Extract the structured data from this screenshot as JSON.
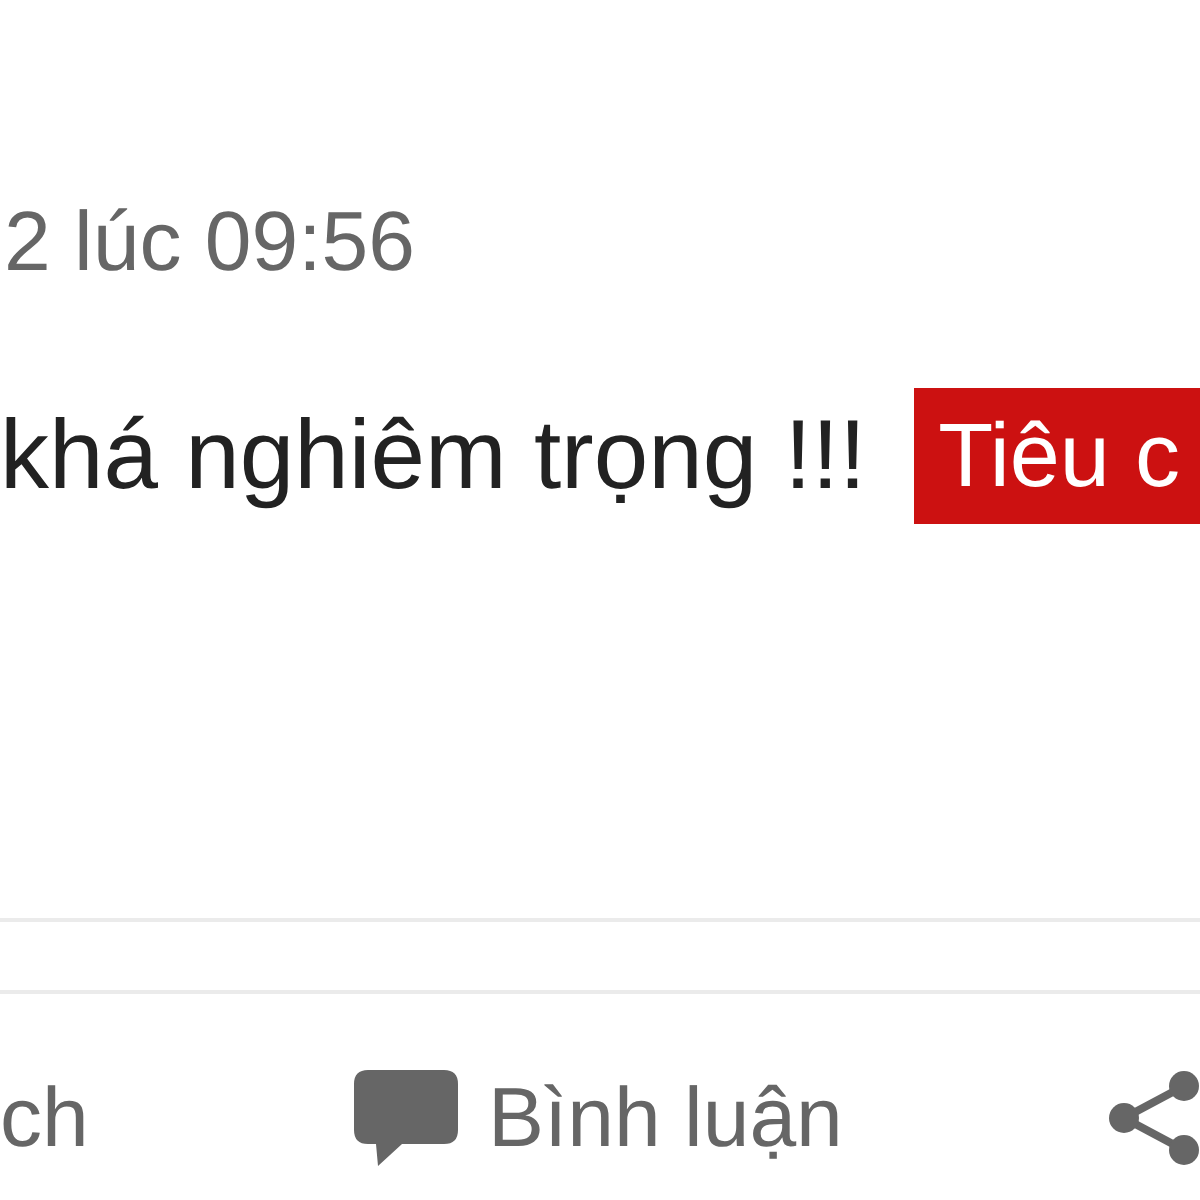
{
  "post": {
    "timestamp": "2 lúc 09:56",
    "text": "khá nghiêm trọng !!!",
    "tag": {
      "label": "Tiêu c"
    }
  },
  "actions": [
    {
      "kind": "text",
      "label": "ch"
    },
    {
      "kind": "comment",
      "label": "Bình luận"
    },
    {
      "kind": "share"
    }
  ]
}
